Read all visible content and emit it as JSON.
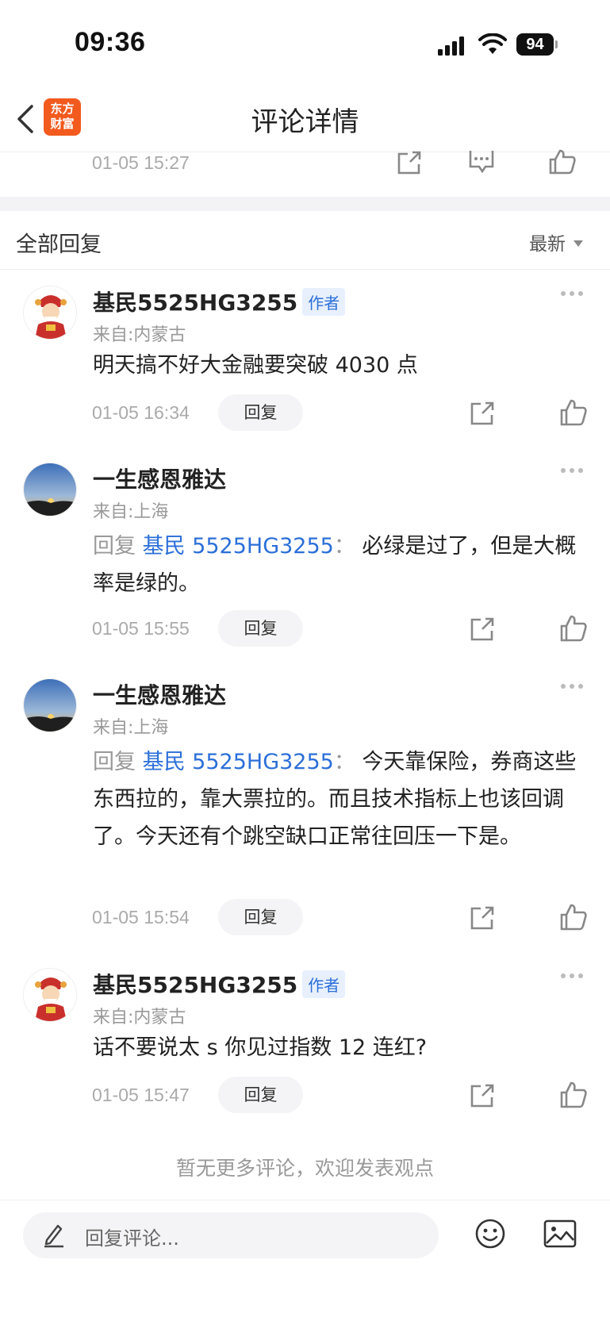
{
  "status_bar": {
    "time": "09:36",
    "battery": "94"
  },
  "nav": {
    "title": "评论详情",
    "logo_line1": "东方",
    "logo_line2": "财富"
  },
  "prev_comment": {
    "time": "01-05 15:27"
  },
  "section": {
    "title": "全部回复",
    "sort_label": "最新"
  },
  "comments": [
    {
      "name": "基民5525HG3255",
      "badge": "作者",
      "location": "来自:内蒙古",
      "content": "明天搞不好大金融要突破 4030 点",
      "time": "01-05 16:34",
      "reply_label": "回复"
    },
    {
      "name": "一生感恩雅达",
      "location": "来自:上海",
      "reply_prefix": "回复",
      "reply_target": "基民 5525HG3255",
      "reply_sep": "：",
      "content": "必绿是过了，但是大概率是绿的。",
      "time": "01-05 15:55",
      "reply_label": "回复"
    },
    {
      "name": "一生感恩雅达",
      "location": "来自:上海",
      "reply_prefix": "回复",
      "reply_target": "基民 5525HG3255",
      "reply_sep": "：",
      "content": "今天靠保险，券商这些东西拉的，靠大票拉的。而且技术指标上也该回调了。今天还有个跳空缺口正常往回压一下是。",
      "time": "01-05 15:54",
      "reply_label": "回复"
    },
    {
      "name": "基民5525HG3255",
      "badge": "作者",
      "location": "来自:内蒙古",
      "content": "话不要说太 s 你见过指数 12 连红?",
      "time": "01-05 15:47",
      "reply_label": "回复"
    }
  ],
  "no_more": "暂无更多评论，欢迎发表观点",
  "bottom_bar": {
    "placeholder": "回复评论..."
  }
}
